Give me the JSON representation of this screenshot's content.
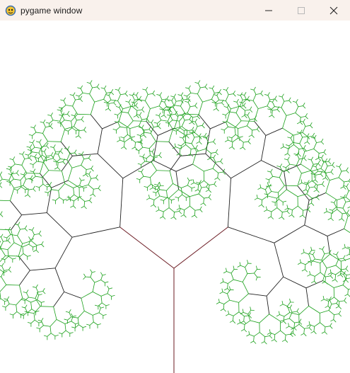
{
  "window": {
    "title": "pygame window",
    "icons": {
      "app": "pygame-snake-icon",
      "minimize": "minimize-icon",
      "maximize": "maximize-icon",
      "close": "close-icon"
    }
  },
  "colors": {
    "titlebar_bg": "#f9f1ec",
    "canvas_bg": "#ffffff",
    "trunk": "#6b1a22",
    "branch": "#202020",
    "leaves": "#1aa01a"
  }
}
